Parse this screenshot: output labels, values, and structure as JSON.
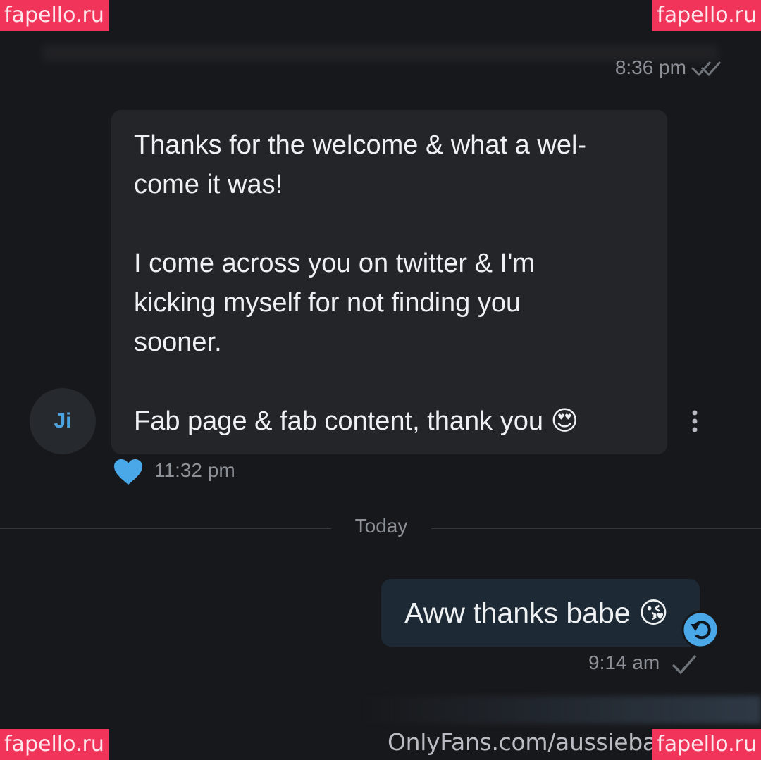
{
  "watermarks": {
    "top_left": "fapello.ru",
    "top_right": "fapello.ru",
    "bottom_left": "fapello.ru",
    "bottom_right": "fapello.ru"
  },
  "previous_message": {
    "time": "8:36 pm",
    "status_icon": "double-check-icon"
  },
  "incoming_message": {
    "avatar_initials": "Ji",
    "paragraphs": [
      "Thanks for the welcome & what a wel-\ncome it was!",
      "I come across you on twitter & I'm\nkicking myself for not finding you\nsooner.",
      "Fab page & fab content, thank you 😍"
    ],
    "time": "11:32 pm",
    "reaction_icon": "heart-icon",
    "menu_icon": "more-vertical-icon"
  },
  "date_separator": "Today",
  "outgoing_message": {
    "text": "Aww thanks babe 😘",
    "time": "9:14 am",
    "status_icon": "check-icon",
    "action_icon": "undo-icon"
  },
  "footer_caption": "OnlyFans.com/aussiebar",
  "colors": {
    "background": "#17181b",
    "incoming_bubble": "#232528",
    "outgoing_bubble": "#1d2a35",
    "accent": "#4aa3df",
    "watermark": "#f1345a"
  }
}
